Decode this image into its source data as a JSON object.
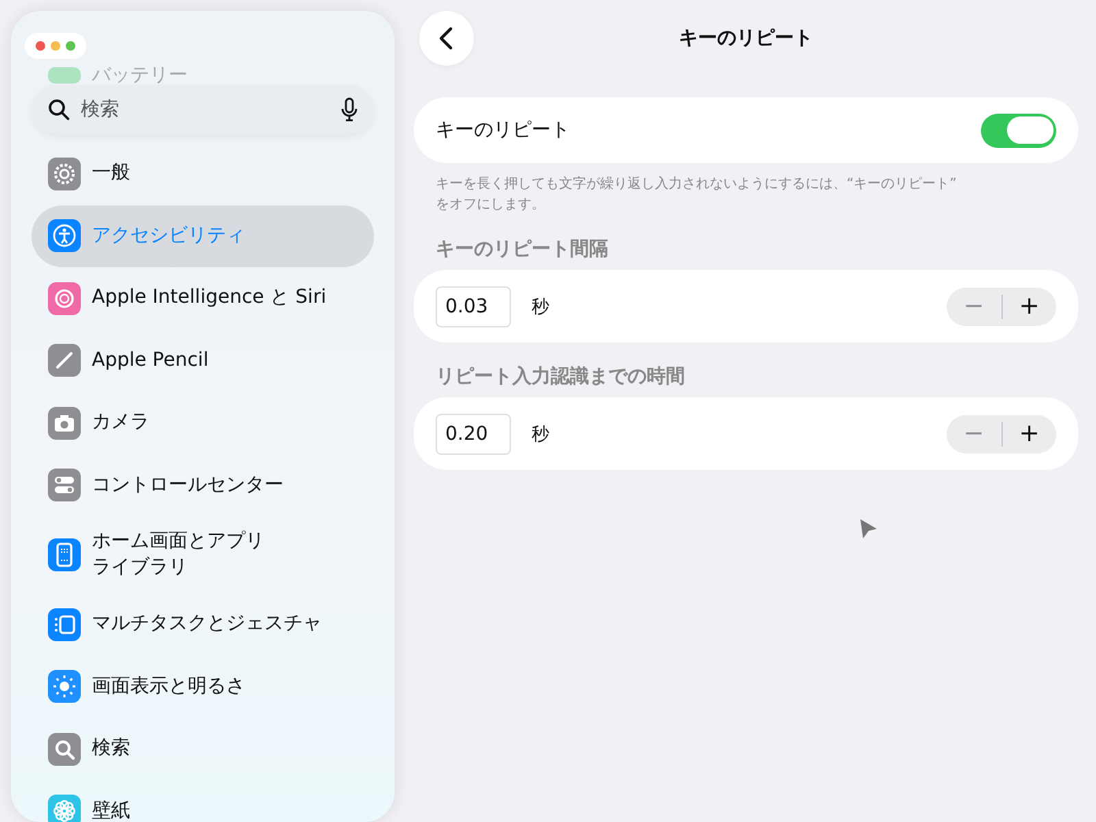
{
  "sidebar": {
    "faded_item": {
      "label": "バッテリー"
    },
    "search": {
      "placeholder": "検索"
    },
    "items": [
      {
        "label": "一般",
        "color": "#8e8e93",
        "selected": false
      },
      {
        "label": "アクセシビリティ",
        "color": "#0a84ff",
        "selected": true
      },
      {
        "label": "Apple Intelligence と Siri",
        "color": "#f06aa8",
        "selected": false
      },
      {
        "label": "Apple Pencil",
        "color": "#8e8e93",
        "selected": false
      },
      {
        "label": "カメラ",
        "color": "#8e8e93",
        "selected": false
      },
      {
        "label": "コントロールセンター",
        "color": "#8e8e93",
        "selected": false
      },
      {
        "label": "ホーム画面とアプリライブラリ",
        "color": "#0a84ff",
        "selected": false
      },
      {
        "label": "マルチタスクとジェスチャ",
        "color": "#0a84ff",
        "selected": false
      },
      {
        "label": "画面表示と明るさ",
        "color": "#1e90ff",
        "selected": false
      },
      {
        "label": "検索",
        "color": "#8e8e93",
        "selected": false
      },
      {
        "label": "壁紙",
        "color": "#2ec4e8",
        "selected": false
      }
    ]
  },
  "detail": {
    "title": "キーのリピート",
    "toggle": {
      "label": "キーのリピート",
      "on": true
    },
    "footnote": "キーを長く押しても文字が繰り返し入力されないようにするには、“キーのリピート”\nをオフにします。",
    "sections": [
      {
        "header": "キーのリピート間隔",
        "value": "0.03",
        "unit": "秒",
        "minus_disabled": true,
        "minus": "−",
        "plus": "+"
      },
      {
        "header": "リピート入力認識までの時間",
        "value": "0.20",
        "unit": "秒",
        "minus_disabled": true,
        "minus": "−",
        "plus": "+"
      }
    ]
  }
}
